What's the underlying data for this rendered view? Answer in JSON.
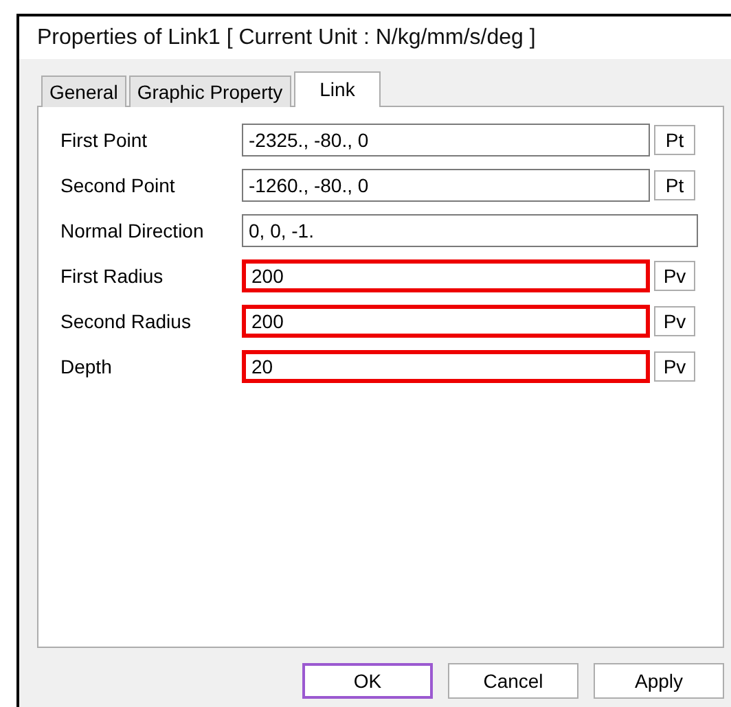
{
  "window": {
    "title": "Properties of Link1 [ Current Unit : N/kg/mm/s/deg ]"
  },
  "tabs": [
    {
      "label": "General",
      "selected": false
    },
    {
      "label": "Graphic Property",
      "selected": false
    },
    {
      "label": "Link",
      "selected": true
    }
  ],
  "fields": [
    {
      "label": "First Point",
      "value": "-2325., -80., 0",
      "highlighted": false,
      "button": "Pt"
    },
    {
      "label": "Second Point",
      "value": "-1260., -80., 0",
      "highlighted": false,
      "button": "Pt"
    },
    {
      "label": "Normal Direction",
      "value": "0, 0, -1.",
      "highlighted": false
    },
    {
      "label": "First Radius",
      "value": "200",
      "highlighted": true,
      "button": "Pv"
    },
    {
      "label": "Second Radius",
      "value": "200",
      "highlighted": true,
      "button": "Pv"
    },
    {
      "label": "Depth",
      "value": "20",
      "highlighted": true,
      "button": "Pv"
    }
  ],
  "buttons": [
    {
      "label": "OK",
      "default": true
    },
    {
      "label": "Cancel",
      "default": false
    },
    {
      "label": "Apply",
      "default": false
    }
  ]
}
